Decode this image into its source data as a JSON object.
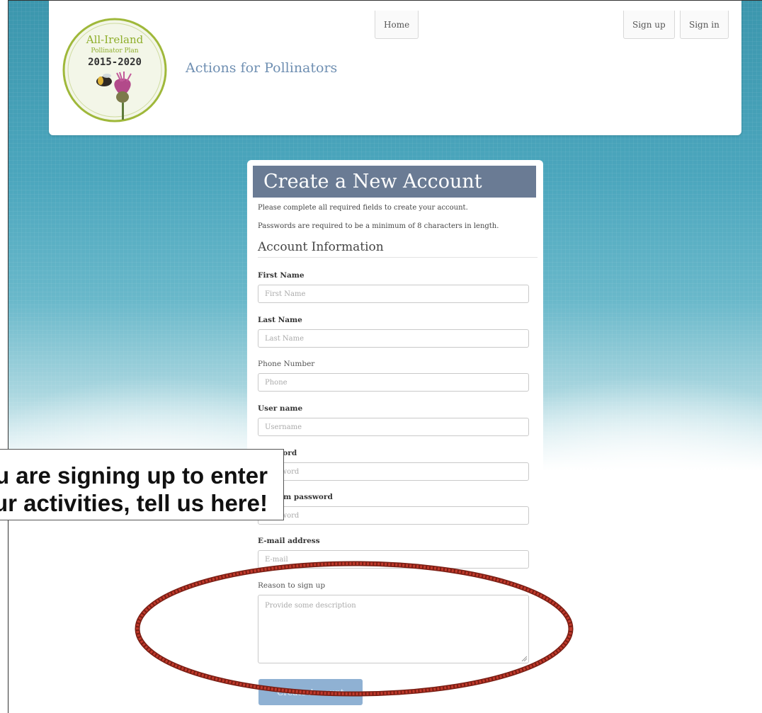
{
  "header": {
    "logo": {
      "line1": "All-Ireland",
      "line2": "Pollinator Plan",
      "line3": "2015-2020"
    },
    "brand": "Actions for Pollinators",
    "nav": {
      "home": "Home",
      "sign_up": "Sign up",
      "sign_in": "Sign in"
    }
  },
  "form": {
    "title": "Create a New Account",
    "note1": "Please complete all required fields to create your account.",
    "note2": "Passwords are required to be a minimum of 8 characters in length.",
    "section": "Account Information",
    "fields": [
      {
        "label": "First Name",
        "placeholder": "First Name"
      },
      {
        "label": "Last Name",
        "placeholder": "Last Name"
      },
      {
        "label": "Phone Number",
        "placeholder": "Phone"
      },
      {
        "label": "User name",
        "placeholder": "Username"
      },
      {
        "label": "Password",
        "placeholder": "Password"
      },
      {
        "label": "Confirm password",
        "placeholder": "Password"
      },
      {
        "label": "E-mail address",
        "placeholder": "E-mail"
      }
    ],
    "reason_label": "Reason to sign up",
    "reason_placeholder": "Provide some description",
    "submit": "Create Account"
  },
  "callout": {
    "line1": "If you are signing up to enter",
    "line2": "your activities, tell us here!"
  },
  "colors": {
    "title_bar": "#6a7b94",
    "brand_text": "#6f8fb2",
    "submit_button": "#8fb1d3",
    "highlight_ellipse": "#c0392b"
  }
}
